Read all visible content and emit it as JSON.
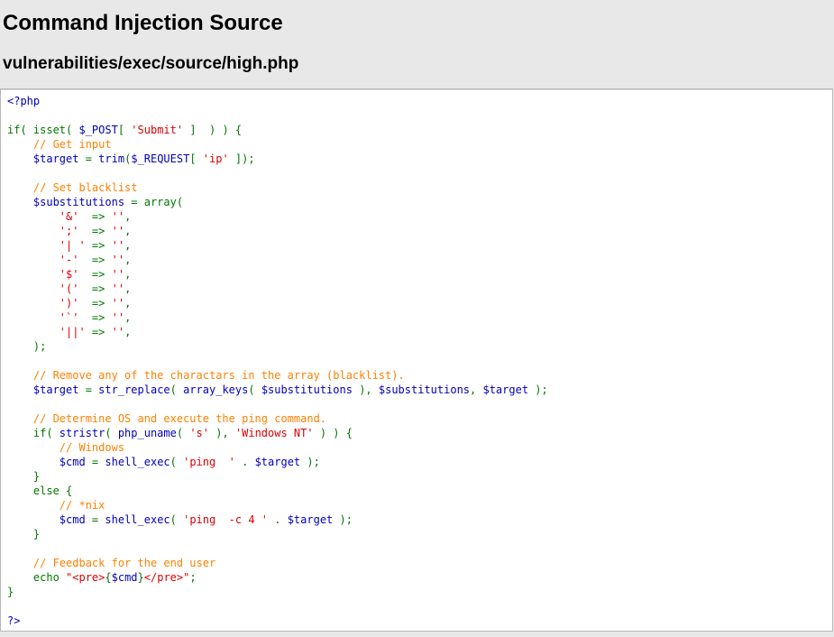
{
  "header": {
    "title": "Command Injection Source",
    "subtitle": "vulnerabilities/exec/source/high.php"
  },
  "code": {
    "lines": [
      [
        {
          "cls": "tag",
          "text": "<?php"
        }
      ],
      [],
      [
        {
          "cls": "plain",
          "text": "if( isset( "
        },
        {
          "cls": "var",
          "text": "$_POST"
        },
        {
          "cls": "plain",
          "text": "[ "
        },
        {
          "cls": "string",
          "text": "'Submit'"
        },
        {
          "cls": "plain",
          "text": " ]  ) ) {"
        }
      ],
      [
        {
          "cls": "plain",
          "text": "    "
        },
        {
          "cls": "comment",
          "text": "// Get input"
        }
      ],
      [
        {
          "cls": "plain",
          "text": "    "
        },
        {
          "cls": "var",
          "text": "$target"
        },
        {
          "cls": "plain",
          "text": " = "
        },
        {
          "cls": "var",
          "text": "trim"
        },
        {
          "cls": "plain",
          "text": "("
        },
        {
          "cls": "var",
          "text": "$_REQUEST"
        },
        {
          "cls": "plain",
          "text": "[ "
        },
        {
          "cls": "string",
          "text": "'ip'"
        },
        {
          "cls": "plain",
          "text": " ]);"
        }
      ],
      [],
      [
        {
          "cls": "plain",
          "text": "    "
        },
        {
          "cls": "comment",
          "text": "// Set blacklist"
        }
      ],
      [
        {
          "cls": "plain",
          "text": "    "
        },
        {
          "cls": "var",
          "text": "$substitutions"
        },
        {
          "cls": "plain",
          "text": " = array("
        }
      ],
      [
        {
          "cls": "plain",
          "text": "        "
        },
        {
          "cls": "string",
          "text": "'&'"
        },
        {
          "cls": "plain",
          "text": "  => "
        },
        {
          "cls": "string",
          "text": "''"
        },
        {
          "cls": "plain",
          "text": ","
        }
      ],
      [
        {
          "cls": "plain",
          "text": "        "
        },
        {
          "cls": "string",
          "text": "';'"
        },
        {
          "cls": "plain",
          "text": "  => "
        },
        {
          "cls": "string",
          "text": "''"
        },
        {
          "cls": "plain",
          "text": ","
        }
      ],
      [
        {
          "cls": "plain",
          "text": "        "
        },
        {
          "cls": "string",
          "text": "'| '"
        },
        {
          "cls": "plain",
          "text": " => "
        },
        {
          "cls": "string",
          "text": "''"
        },
        {
          "cls": "plain",
          "text": ","
        }
      ],
      [
        {
          "cls": "plain",
          "text": "        "
        },
        {
          "cls": "string",
          "text": "'-'"
        },
        {
          "cls": "plain",
          "text": "  => "
        },
        {
          "cls": "string",
          "text": "''"
        },
        {
          "cls": "plain",
          "text": ","
        }
      ],
      [
        {
          "cls": "plain",
          "text": "        "
        },
        {
          "cls": "string",
          "text": "'$'"
        },
        {
          "cls": "plain",
          "text": "  => "
        },
        {
          "cls": "string",
          "text": "''"
        },
        {
          "cls": "plain",
          "text": ","
        }
      ],
      [
        {
          "cls": "plain",
          "text": "        "
        },
        {
          "cls": "string",
          "text": "'('"
        },
        {
          "cls": "plain",
          "text": "  => "
        },
        {
          "cls": "string",
          "text": "''"
        },
        {
          "cls": "plain",
          "text": ","
        }
      ],
      [
        {
          "cls": "plain",
          "text": "        "
        },
        {
          "cls": "string",
          "text": "')'"
        },
        {
          "cls": "plain",
          "text": "  => "
        },
        {
          "cls": "string",
          "text": "''"
        },
        {
          "cls": "plain",
          "text": ","
        }
      ],
      [
        {
          "cls": "plain",
          "text": "        "
        },
        {
          "cls": "string",
          "text": "'`'"
        },
        {
          "cls": "plain",
          "text": "  => "
        },
        {
          "cls": "string",
          "text": "''"
        },
        {
          "cls": "plain",
          "text": ","
        }
      ],
      [
        {
          "cls": "plain",
          "text": "        "
        },
        {
          "cls": "string",
          "text": "'||'"
        },
        {
          "cls": "plain",
          "text": " => "
        },
        {
          "cls": "string",
          "text": "''"
        },
        {
          "cls": "plain",
          "text": ","
        }
      ],
      [
        {
          "cls": "plain",
          "text": "    );"
        }
      ],
      [],
      [
        {
          "cls": "plain",
          "text": "    "
        },
        {
          "cls": "comment",
          "text": "// Remove any of the charactars in the array (blacklist)."
        }
      ],
      [
        {
          "cls": "plain",
          "text": "    "
        },
        {
          "cls": "var",
          "text": "$target"
        },
        {
          "cls": "plain",
          "text": " = "
        },
        {
          "cls": "var",
          "text": "str_replace"
        },
        {
          "cls": "plain",
          "text": "( "
        },
        {
          "cls": "var",
          "text": "array_keys"
        },
        {
          "cls": "plain",
          "text": "( "
        },
        {
          "cls": "var",
          "text": "$substitutions"
        },
        {
          "cls": "plain",
          "text": " ), "
        },
        {
          "cls": "var",
          "text": "$substitutions"
        },
        {
          "cls": "plain",
          "text": ", "
        },
        {
          "cls": "var",
          "text": "$target"
        },
        {
          "cls": "plain",
          "text": " );"
        }
      ],
      [],
      [
        {
          "cls": "plain",
          "text": "    "
        },
        {
          "cls": "comment",
          "text": "// Determine OS and execute the ping command."
        }
      ],
      [
        {
          "cls": "plain",
          "text": "    if( "
        },
        {
          "cls": "var",
          "text": "stristr"
        },
        {
          "cls": "plain",
          "text": "( "
        },
        {
          "cls": "var",
          "text": "php_uname"
        },
        {
          "cls": "plain",
          "text": "( "
        },
        {
          "cls": "string",
          "text": "'s'"
        },
        {
          "cls": "plain",
          "text": " ), "
        },
        {
          "cls": "string",
          "text": "'Windows NT'"
        },
        {
          "cls": "plain",
          "text": " ) ) {"
        }
      ],
      [
        {
          "cls": "plain",
          "text": "        "
        },
        {
          "cls": "comment",
          "text": "// Windows"
        }
      ],
      [
        {
          "cls": "plain",
          "text": "        "
        },
        {
          "cls": "var",
          "text": "$cmd"
        },
        {
          "cls": "plain",
          "text": " = "
        },
        {
          "cls": "var",
          "text": "shell_exec"
        },
        {
          "cls": "plain",
          "text": "( "
        },
        {
          "cls": "string",
          "text": "'ping  '"
        },
        {
          "cls": "plain",
          "text": " . "
        },
        {
          "cls": "var",
          "text": "$target"
        },
        {
          "cls": "plain",
          "text": " );"
        }
      ],
      [
        {
          "cls": "plain",
          "text": "    }"
        }
      ],
      [
        {
          "cls": "plain",
          "text": "    else {"
        }
      ],
      [
        {
          "cls": "plain",
          "text": "        "
        },
        {
          "cls": "comment",
          "text": "// *nix"
        }
      ],
      [
        {
          "cls": "plain",
          "text": "        "
        },
        {
          "cls": "var",
          "text": "$cmd"
        },
        {
          "cls": "plain",
          "text": " = "
        },
        {
          "cls": "var",
          "text": "shell_exec"
        },
        {
          "cls": "plain",
          "text": "( "
        },
        {
          "cls": "string",
          "text": "'ping  -c 4 '"
        },
        {
          "cls": "plain",
          "text": " . "
        },
        {
          "cls": "var",
          "text": "$target"
        },
        {
          "cls": "plain",
          "text": " );"
        }
      ],
      [
        {
          "cls": "plain",
          "text": "    }"
        }
      ],
      [],
      [
        {
          "cls": "plain",
          "text": "    "
        },
        {
          "cls": "comment",
          "text": "// Feedback for the end user"
        }
      ],
      [
        {
          "cls": "plain",
          "text": "    echo "
        },
        {
          "cls": "string",
          "text": "\"<pre>"
        },
        {
          "cls": "plain",
          "text": "{"
        },
        {
          "cls": "var",
          "text": "$cmd"
        },
        {
          "cls": "plain",
          "text": "}"
        },
        {
          "cls": "string",
          "text": "</pre>\""
        },
        {
          "cls": "plain",
          "text": ";"
        }
      ],
      [
        {
          "cls": "plain",
          "text": "}"
        }
      ],
      [],
      [
        {
          "cls": "tag",
          "text": "?>"
        }
      ]
    ]
  }
}
